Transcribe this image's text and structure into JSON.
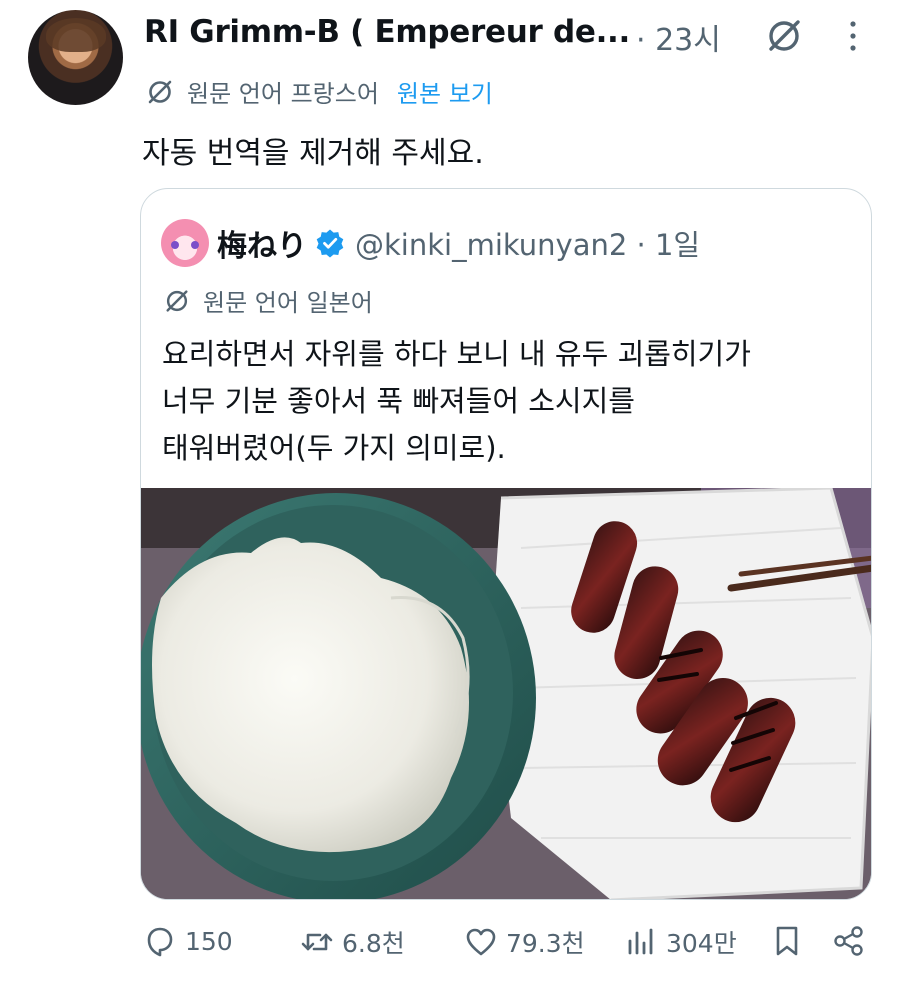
{
  "author": {
    "name": "RI Grimm-B ( Empereur de...",
    "time": "· 23시"
  },
  "translation": {
    "label": "원문 언어 프랑스어",
    "view_original": "원본 보기"
  },
  "tweet_text": "자동 번역을 제거해 주세요.",
  "quote": {
    "name": "梅ねり",
    "handle": "@kinki_mikunyan2 · 1일",
    "translation_label": "원문 언어 일본어",
    "text_lines": [
      "요리하면서 자위를 하다 보니 내 유두 괴롭히기가",
      "너무 기분 좋아서 푹 빠져들어 소시지를",
      "태워버렸어(두 가지 의미로)."
    ],
    "media": {
      "content": "photo-bowl-of-rice-and-burnt-sausages"
    }
  },
  "actions": {
    "replies": "150",
    "retweets": "6.8천",
    "likes": "79.3천",
    "views": "304만"
  },
  "colors": {
    "text": "#0f1419",
    "secondary": "#536471",
    "link": "#1d9bf0",
    "border": "#cfd9de",
    "verified": "#1d9bf0"
  },
  "icons": [
    "grok-icon",
    "more-icon",
    "translate-icon",
    "verified-icon",
    "reply-icon",
    "retweet-icon",
    "like-icon",
    "views-icon",
    "bookmark-icon",
    "share-icon"
  ]
}
